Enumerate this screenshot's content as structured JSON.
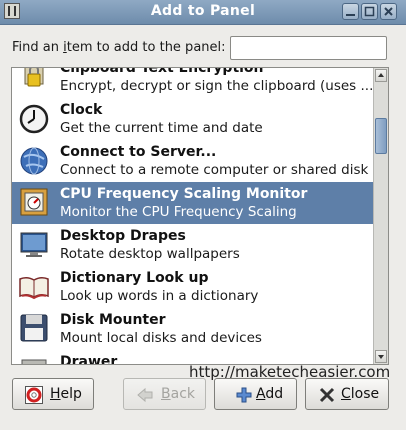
{
  "window": {
    "title": "Add to Panel"
  },
  "search": {
    "label_prefix": "Find an ",
    "label_mnemonic": "i",
    "label_suffix": "tem to add to the panel:",
    "value": "",
    "placeholder": ""
  },
  "items": [
    {
      "name": "Clipboard Text Encryption",
      "desc": "Encrypt, decrypt or sign the clipboard (uses ...",
      "icon": "lock-icon"
    },
    {
      "name": "Clock",
      "desc": "Get the current time and date",
      "icon": "clock-icon"
    },
    {
      "name": "Connect to Server...",
      "desc": "Connect to a remote computer or shared disk",
      "icon": "globe-icon"
    },
    {
      "name": "CPU Frequency Scaling Monitor",
      "desc": "Monitor the CPU Frequency Scaling",
      "icon": "cpu-gauge-icon"
    },
    {
      "name": "Desktop Drapes",
      "desc": "Rotate desktop wallpapers",
      "icon": "monitor-icon"
    },
    {
      "name": "Dictionary Look up",
      "desc": "Look up words in a dictionary",
      "icon": "book-icon"
    },
    {
      "name": "Disk Mounter",
      "desc": "Mount local disks and devices",
      "icon": "floppy-icon"
    },
    {
      "name": "Drawer",
      "desc": "",
      "icon": "drawer-icon"
    }
  ],
  "selected_index": 3,
  "buttons": {
    "help": {
      "mnemonic": "H",
      "rest": "elp"
    },
    "back": {
      "mnemonic": "B",
      "rest": "ack"
    },
    "add": {
      "mnemonic": "A",
      "rest": "dd"
    },
    "close": {
      "mnemonic": "C",
      "rest": "lose"
    }
  },
  "watermark": "http://maketecheasier.com",
  "colors": {
    "selection": "#5e7fa8",
    "titlebar": "#7f9bb9"
  }
}
